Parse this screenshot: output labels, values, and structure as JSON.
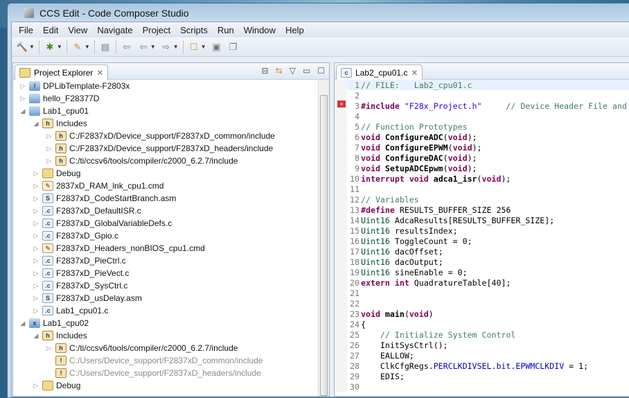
{
  "window": {
    "title": "CCS Edit - Code Composer Studio"
  },
  "menu": [
    "File",
    "Edit",
    "View",
    "Navigate",
    "Project",
    "Scripts",
    "Run",
    "Window",
    "Help"
  ],
  "explorer": {
    "tab_label": "Project Explorer",
    "items": [
      {
        "level": 0,
        "arrow": "closed",
        "icon": "project-warning",
        "label": "DPLibTemplate-F2803x"
      },
      {
        "level": 0,
        "arrow": "closed",
        "icon": "project",
        "label": "hello_F28377D"
      },
      {
        "level": 0,
        "arrow": "open",
        "icon": "project",
        "label": "Lab1_cpu01"
      },
      {
        "level": 1,
        "arrow": "open",
        "icon": "includes",
        "label": "Includes"
      },
      {
        "level": 2,
        "arrow": "closed",
        "icon": "include-folder",
        "label": "C:/F2837xD/Device_support/F2837xD_common/include"
      },
      {
        "level": 2,
        "arrow": "closed",
        "icon": "include-folder",
        "label": "C:/F2837xD/Device_support/F2837xD_headers/include"
      },
      {
        "level": 2,
        "arrow": "closed",
        "icon": "include-folder",
        "label": "C:/ti/ccsv6/tools/compiler/c2000_6.2.7/include"
      },
      {
        "level": 1,
        "arrow": "closed",
        "icon": "folder",
        "label": "Debug"
      },
      {
        "level": 1,
        "arrow": "closed",
        "icon": "cmd",
        "label": "2837xD_RAM_lnk_cpu1.cmd"
      },
      {
        "level": 1,
        "arrow": "closed",
        "icon": "asm",
        "label": "F2837xD_CodeStartBranch.asm"
      },
      {
        "level": 1,
        "arrow": "closed",
        "icon": "c",
        "label": "F2837xD_DefaultISR.c"
      },
      {
        "level": 1,
        "arrow": "closed",
        "icon": "c",
        "label": "F2837xD_GlobalVariableDefs.c"
      },
      {
        "level": 1,
        "arrow": "closed",
        "icon": "c",
        "label": "F2837xD_Gpio.c"
      },
      {
        "level": 1,
        "arrow": "closed",
        "icon": "cmd",
        "label": "F2837xD_Headers_nonBIOS_cpu1.cmd"
      },
      {
        "level": 1,
        "arrow": "closed",
        "icon": "c",
        "label": "F2837xD_PieCtrl.c"
      },
      {
        "level": 1,
        "arrow": "closed",
        "icon": "c",
        "label": "F2837xD_PieVect.c"
      },
      {
        "level": 1,
        "arrow": "closed",
        "icon": "c",
        "label": "F2837xD_SysCtrl.c"
      },
      {
        "level": 1,
        "arrow": "closed",
        "icon": "asm",
        "label": "F2837xD_usDelay.asm"
      },
      {
        "level": 1,
        "arrow": "closed",
        "icon": "c",
        "label": "Lab1_cpu01.c"
      },
      {
        "level": 0,
        "arrow": "open",
        "icon": "project-error",
        "label": "Lab1_cpu02"
      },
      {
        "level": 1,
        "arrow": "open",
        "icon": "includes",
        "label": "Includes"
      },
      {
        "level": 2,
        "arrow": "closed",
        "icon": "include-folder",
        "label": "C:/ti/ccsv6/tools/compiler/c2000_6.2.7/include"
      },
      {
        "level": 2,
        "arrow": "none",
        "icon": "include-warning",
        "label": "C:/Users/Device_support/F2837xD_common/include",
        "gray": true
      },
      {
        "level": 2,
        "arrow": "none",
        "icon": "include-warning",
        "label": "C:/Users/Device_support/F2837xD_headers/include",
        "gray": true
      },
      {
        "level": 1,
        "arrow": "closed",
        "icon": "folder",
        "label": "Debug"
      }
    ]
  },
  "editor": {
    "tab_label": "Lab2_cpu01.c",
    "lines": [
      [
        [
          "cm",
          "// FILE:   Lab2_cpu01.c"
        ]
      ],
      [],
      [
        [
          "kw",
          "#include"
        ],
        [
          "pl",
          " "
        ],
        [
          "str",
          "\"F28x_Project.h\""
        ],
        [
          "pl",
          "     "
        ],
        [
          "cm",
          "// Device Header File and"
        ]
      ],
      [],
      [
        [
          "cm",
          "// Function Prototypes"
        ]
      ],
      [
        [
          "kw",
          "void"
        ],
        [
          "pl",
          " "
        ],
        [
          "fn",
          "ConfigureADC"
        ],
        [
          "pl",
          "("
        ],
        [
          "kw",
          "void"
        ],
        [
          "pl",
          ");"
        ]
      ],
      [
        [
          "kw",
          "void"
        ],
        [
          "pl",
          " "
        ],
        [
          "fn",
          "ConfigureEPWM"
        ],
        [
          "pl",
          "("
        ],
        [
          "kw",
          "void"
        ],
        [
          "pl",
          ");"
        ]
      ],
      [
        [
          "kw",
          "void"
        ],
        [
          "pl",
          " "
        ],
        [
          "fn",
          "ConfigureDAC"
        ],
        [
          "pl",
          "("
        ],
        [
          "kw",
          "void"
        ],
        [
          "pl",
          ");"
        ]
      ],
      [
        [
          "kw",
          "void"
        ],
        [
          "pl",
          " "
        ],
        [
          "fn",
          "SetupADCEpwm"
        ],
        [
          "pl",
          "("
        ],
        [
          "kw",
          "void"
        ],
        [
          "pl",
          ");"
        ]
      ],
      [
        [
          "kw",
          "interrupt"
        ],
        [
          "pl",
          " "
        ],
        [
          "kw",
          "void"
        ],
        [
          "pl",
          " "
        ],
        [
          "fn",
          "adca1_isr"
        ],
        [
          "pl",
          "("
        ],
        [
          "kw",
          "void"
        ],
        [
          "pl",
          ");"
        ]
      ],
      [],
      [
        [
          "cm",
          "// Variables"
        ]
      ],
      [
        [
          "kw",
          "#define"
        ],
        [
          "pl",
          " RESULTS_BUFFER_SIZE 256"
        ]
      ],
      [
        [
          "ty",
          "Uint16"
        ],
        [
          "pl",
          " AdcaResults[RESULTS_BUFFER_SIZE];"
        ]
      ],
      [
        [
          "ty",
          "Uint16"
        ],
        [
          "pl",
          " resultsIndex;"
        ]
      ],
      [
        [
          "ty",
          "Uint16"
        ],
        [
          "pl",
          " ToggleCount = 0;"
        ]
      ],
      [
        [
          "ty",
          "Uint16"
        ],
        [
          "pl",
          " dacOffset;"
        ]
      ],
      [
        [
          "ty",
          "Uint16"
        ],
        [
          "pl",
          " dacOutput;"
        ]
      ],
      [
        [
          "ty",
          "Uint16"
        ],
        [
          "pl",
          " sineEnable = 0;"
        ]
      ],
      [
        [
          "kw",
          "extern"
        ],
        [
          "pl",
          " "
        ],
        [
          "kw",
          "int"
        ],
        [
          "pl",
          " QuadratureTable[40];"
        ]
      ],
      [],
      [],
      [
        [
          "kw",
          "void"
        ],
        [
          "pl",
          " "
        ],
        [
          "fn",
          "main"
        ],
        [
          "pl",
          "("
        ],
        [
          "kw",
          "void"
        ],
        [
          "pl",
          ")"
        ]
      ],
      [
        [
          "pl",
          "{"
        ]
      ],
      [
        [
          "pl",
          "    "
        ],
        [
          "cm",
          "// Initialize System Control"
        ]
      ],
      [
        [
          "pl",
          "    InitSysCtrl();"
        ]
      ],
      [
        [
          "pl",
          "    EALLOW;"
        ]
      ],
      [
        [
          "pl",
          "    ClkCfgRegs."
        ],
        [
          "fld",
          "PERCLKDIVSEL"
        ],
        [
          "pl",
          "."
        ],
        [
          "fld",
          "bit"
        ],
        [
          "pl",
          "."
        ],
        [
          "fld",
          "EPWMCLKDIV"
        ],
        [
          "pl",
          " = 1;"
        ]
      ],
      [
        [
          "pl",
          "    EDIS;"
        ]
      ],
      []
    ]
  }
}
